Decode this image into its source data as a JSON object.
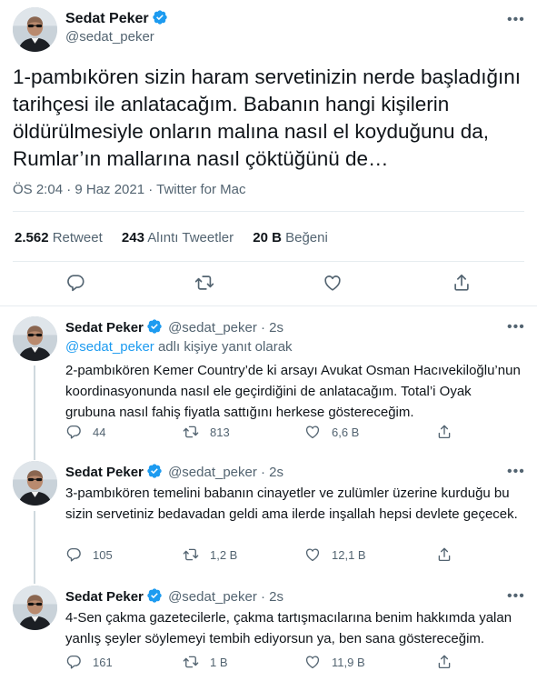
{
  "main": {
    "name": "Sedat Peker",
    "handle": "@sedat_peker",
    "text": "1-pambıkören sizin haram servetinizin nerde başladığını tarihçesi ile anlatacağım. Babanın hangi kişilerin öldürülmesiyle onların malına nasıl el koyduğunu da, Rumlar’ın mallarına nasıl çöktüğünü de…",
    "meta": "ÖS 2:04 · 9 Haz 2021 · Twitter for Mac",
    "stats": [
      {
        "num": "2.562",
        "label": "Retweet"
      },
      {
        "num": "243",
        "label": "Alıntı Tweetler"
      },
      {
        "num": "20 B",
        "label": "Beğeni"
      }
    ]
  },
  "replies": [
    {
      "name": "Sedat Peker",
      "handle": "@sedat_peker · 2s",
      "reply_to_prefix": "@sedat_peker",
      "reply_to_suffix": " adlı kişiye yanıt olarak",
      "text": "2-pambıkören Kemer Country’de ki  arsayı Avukat Osman Hacıvekiloğlu’nun koordinasyonunda nasıl ele geçirdiğini de anlatacağım. Total’i Oyak grubuna nasıl fahiş fiyatla sattığını herkese göstereceğim.",
      "replies": "44",
      "retweets": "813",
      "likes": "6,6 B"
    },
    {
      "name": "Sedat Peker",
      "handle": "@sedat_peker · 2s",
      "text": "3-pambıkören temelini babanın cinayetler ve zulümler üzerine kurduğu bu sizin servetiniz bedavadan geldi ama ilerde inşallah hepsi devlete geçecek.",
      "replies": "105",
      "retweets": "1,2 B",
      "likes": "12,1 B"
    },
    {
      "name": "Sedat Peker",
      "handle": "@sedat_peker · 2s",
      "text": "4-Sen çakma gazetecilerle, çakma tartışmacılarına benim hakkımda yalan yanlış şeyler söylemeyi tembih ediyorsun ya, ben sana göstereceğim.",
      "replies": "161",
      "retweets": "1 B",
      "likes": "11,9 B"
    }
  ],
  "colors": {
    "accent": "#1d9bf0",
    "secondary_text": "#536471",
    "divider": "#e6ecf0"
  },
  "icons": [
    "verified-badge-icon",
    "more-icon",
    "reply-icon",
    "retweet-icon",
    "like-icon",
    "share-icon"
  ]
}
